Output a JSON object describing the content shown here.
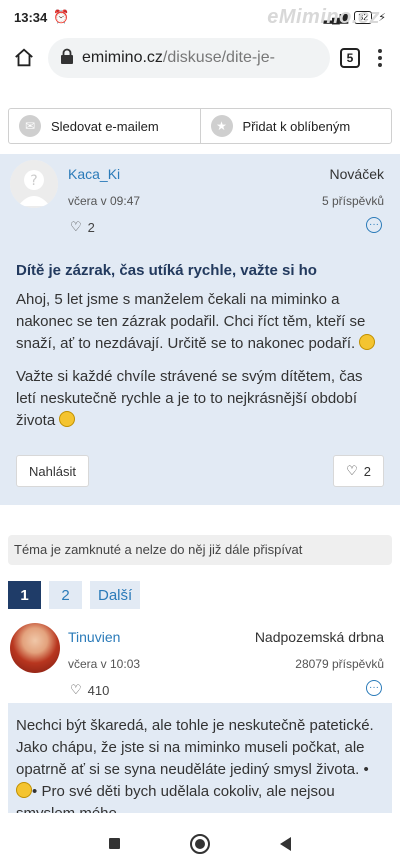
{
  "status_bar": {
    "time": "13:34",
    "battery": "32",
    "watermark": "eMimino.cz"
  },
  "browser": {
    "url_host": "emimino.cz",
    "url_path": "/diskuse/dite-je-",
    "tab_count": "5"
  },
  "actions": {
    "follow_label": "Sledovat e-mailem",
    "favorite_label": "Přidat k oblíbeným"
  },
  "post1": {
    "author": "Kaca_Ki",
    "date": "včera v 09:47",
    "likes": "2",
    "rank": "Nováček",
    "post_count": "5 příspěvků",
    "title": "Dítě je zázrak, čas utíká rychle, važte si ho",
    "paragraphs": [
      "Ahoj, 5 let jsme s manželem čekali na miminko a nakonec se ten zázrak podařil. Chci říct těm, kteří se snaží, ať to nezdávají. Určitě se to nakonec podaří.",
      "Važte si každé chvíle strávené se svým dítětem, čas letí neskutečně rychle a je to to nejkrásnější období života"
    ],
    "report_label": "Nahlásit",
    "like_count": "2"
  },
  "locked_notice": "Téma je zamknuté a nelze do něj již dále přispívat",
  "pagination": {
    "pages": [
      "1",
      "2"
    ],
    "next_label": "Další"
  },
  "post2": {
    "author": "Tinuvien",
    "date": "včera v 10:03",
    "likes": "410",
    "rank": "Nadpozemská drbna",
    "post_count": "28079 příspěvků",
    "text_a": "Nechci být škaredá, ale tohle je neskutečně patetické. Jako chápu, že jste si na miminko museli počkat, ale opatrně ať si se syna neuděláte jediný smysl života.",
    "text_b": "Pro své děti bych udělala cokoliv, ale nejsou smyslem mého"
  },
  "icons": {
    "home": "home-icon",
    "lock": "lock-icon",
    "mail": "mail-icon",
    "star": "star-icon",
    "heart": "heart-icon",
    "more": "more-icon"
  },
  "colors": {
    "accent": "#2b7bb9",
    "post_bg": "#e2eaf4",
    "pager_active": "#1f3c68"
  }
}
